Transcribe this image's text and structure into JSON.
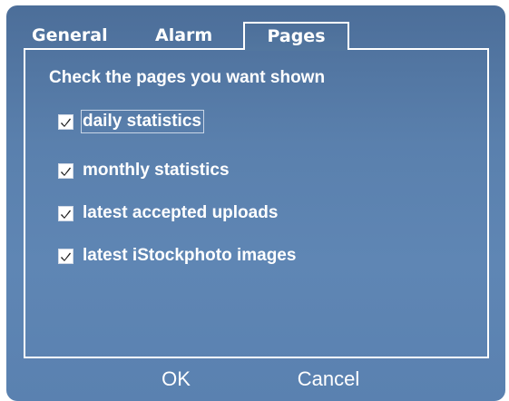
{
  "tabs": [
    {
      "label": "General",
      "selected": false
    },
    {
      "label": "Alarm",
      "selected": false
    },
    {
      "label": "Pages",
      "selected": true
    }
  ],
  "pages_panel": {
    "heading": "Check the pages you want shown",
    "options": [
      {
        "label": "daily statistics",
        "checked": true,
        "focused": true
      },
      {
        "label": "monthly statistics",
        "checked": true,
        "focused": false
      },
      {
        "label": "latest accepted uploads",
        "checked": true,
        "focused": false
      },
      {
        "label": "latest iStockphoto images",
        "checked": true,
        "focused": false
      }
    ]
  },
  "buttons": {
    "ok_label": "OK",
    "cancel_label": "Cancel"
  },
  "colors": {
    "window_background": "#5a80ad",
    "text": "#ffffff",
    "border": "#ffffff"
  },
  "icons": {
    "checkbox_checked": "checkmark-icon"
  }
}
